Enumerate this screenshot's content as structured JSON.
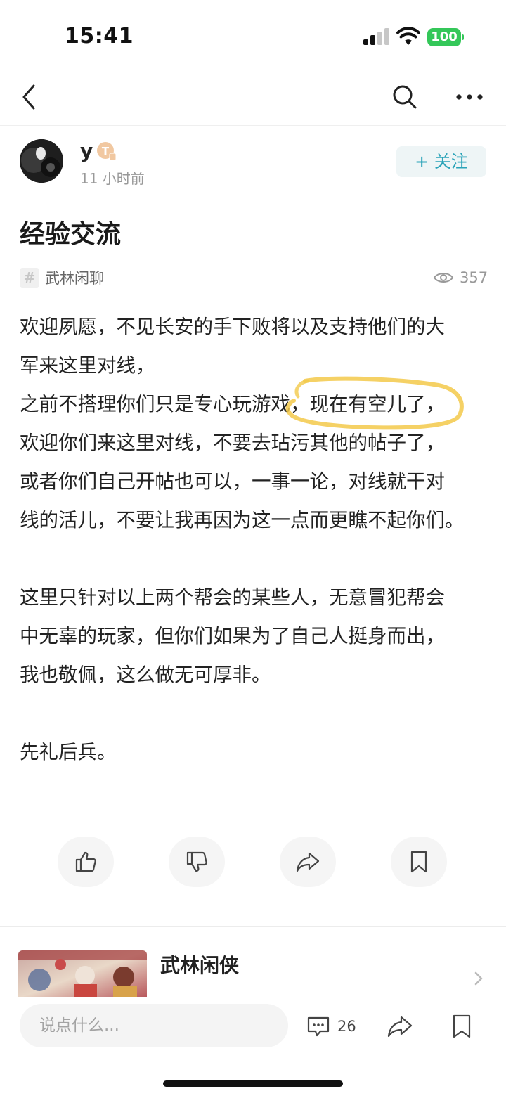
{
  "status_bar": {
    "time": "15:41",
    "battery": "100"
  },
  "post": {
    "author": {
      "name": "y",
      "level_badge": "T",
      "time_ago": "11 小时前"
    },
    "follow_label": "+ 关注",
    "title": "经验交流",
    "topic": "武林闲聊",
    "views": "357",
    "body_lines": [
      "欢迎夙愿，不见长安的手下败将以及支持他们的大",
      "军来这里对线，",
      "之前不搭理你们只是专心玩游戏，现在有空儿了，",
      "欢迎你们来这里对线，不要去玷污其他的帖子了，",
      "或者你们自己开帖也可以，一事一论，对线就干对",
      "线的活儿，不要让我再因为这一点而更瞧不起你们。",
      "",
      "这里只针对以上两个帮会的某些人，无意冒犯帮会",
      "中无辜的玩家，但你们如果为了自己人挺身而出，",
      "我也敬佩，这么做无可厚非。",
      "",
      "先礼后兵。"
    ]
  },
  "reactions": [
    {
      "icon": "thumbs-up-icon"
    },
    {
      "icon": "thumbs-down-icon"
    },
    {
      "icon": "share-icon"
    },
    {
      "icon": "bookmark-icon"
    }
  ],
  "circle": {
    "name": "武林闲侠"
  },
  "bottom_bar": {
    "comment_placeholder": "说点什么...",
    "comment_count": "26"
  },
  "colors": {
    "accent": "#2aa3b8",
    "highlight": "#f3c94a",
    "battery": "#34c759"
  }
}
